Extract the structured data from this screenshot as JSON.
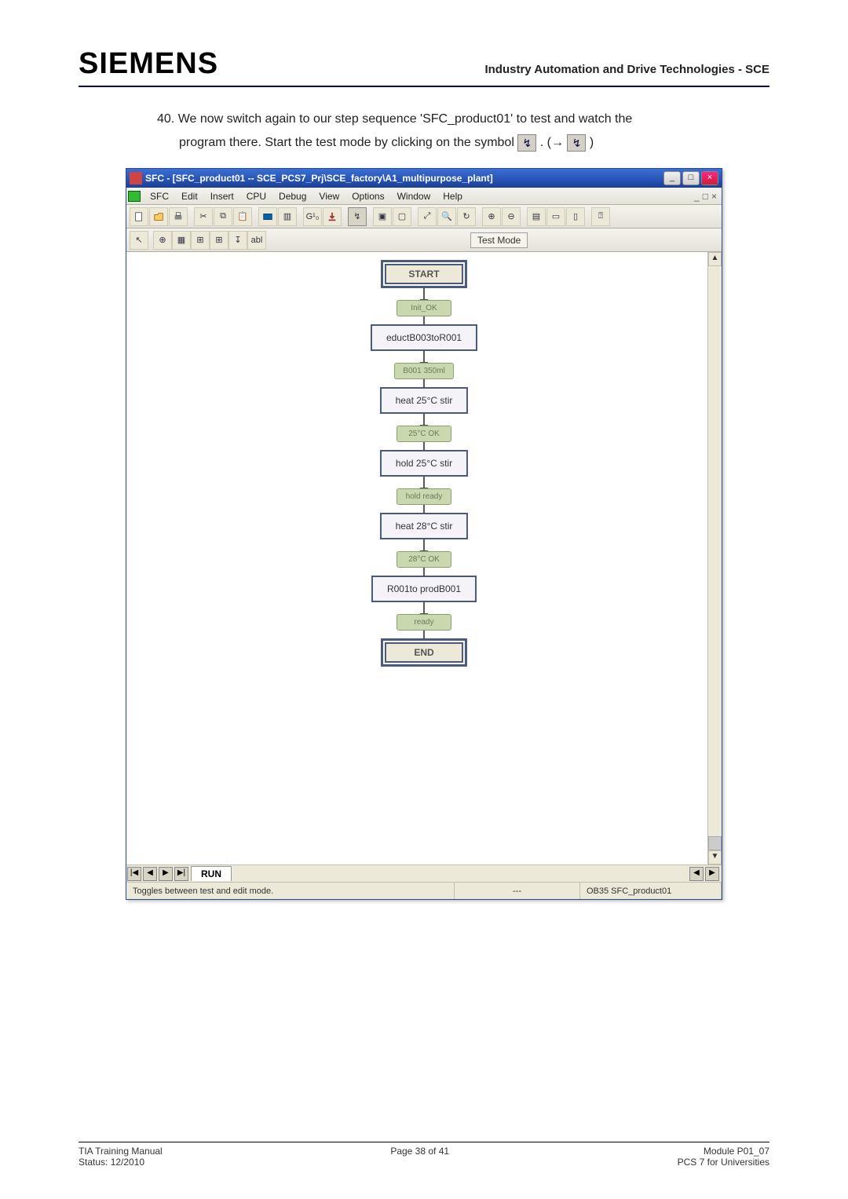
{
  "page": {
    "logo": "SIEMENS",
    "header_right": "Industry Automation and Drive Technologies - SCE",
    "step_number": "40.",
    "step_text_line1": "We now switch again to our step sequence 'SFC_product01' to test and watch the",
    "step_text_line2": "program there. Start the test mode by clicking on the symbol",
    "arrow": ". (→",
    "close_paren": ")"
  },
  "window": {
    "title": "SFC - [SFC_product01 -- SCE_PCS7_Prj\\SCE_factory\\A1_multipurpose_plant]",
    "min": "_",
    "restore": "□",
    "close": "×",
    "menus": [
      "SFC",
      "Edit",
      "Insert",
      "CPU",
      "Debug",
      "View",
      "Options",
      "Window",
      "Help"
    ],
    "doc_controls": [
      "_",
      "□",
      "×"
    ],
    "toolbar2_items": [
      "↖",
      "⊕",
      "▦",
      "⊞",
      "⊞",
      "↧",
      "abl"
    ],
    "test_mode_tooltip": "Test Mode"
  },
  "sfc": {
    "start": "START",
    "t_init": "Init_OK",
    "s_educt": "eductB003toR001",
    "t_350": "B001 350ml",
    "s_heat25": "heat 25°C stir",
    "t_25ok": "25°C OK",
    "s_hold25": "hold 25°C stir",
    "t_holdready": "hold ready",
    "s_heat28": "heat 28°C stir",
    "t_28ok": "28°C OK",
    "s_r001": "R001to prodB001",
    "t_ready": "ready",
    "end": "END"
  },
  "tabs": {
    "nav": [
      "|◀",
      "◀",
      "▶",
      "▶|"
    ],
    "active": "RUN",
    "scroll_l": "◀",
    "scroll_r": "▶"
  },
  "status": {
    "left": "Toggles between test and edit mode.",
    "mid": "---",
    "right": "OB35  SFC_product01"
  },
  "footer": {
    "l1": "TIA Training Manual",
    "l2": "Status: 12/2010",
    "c1": "Page 38 of 41",
    "r1": "Module P01_07",
    "r2": "PCS 7 for Universities"
  }
}
